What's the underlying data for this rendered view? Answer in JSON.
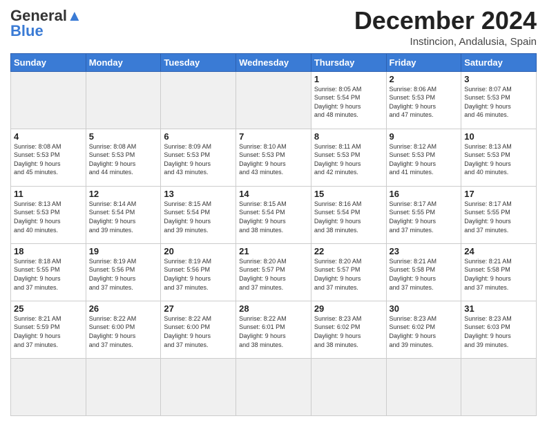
{
  "header": {
    "logo_line1": "General",
    "logo_line2": "Blue",
    "month": "December 2024",
    "location": "Instincion, Andalusia, Spain"
  },
  "weekdays": [
    "Sunday",
    "Monday",
    "Tuesday",
    "Wednesday",
    "Thursday",
    "Friday",
    "Saturday"
  ],
  "days": [
    {
      "num": "",
      "info": ""
    },
    {
      "num": "",
      "info": ""
    },
    {
      "num": "",
      "info": ""
    },
    {
      "num": "",
      "info": ""
    },
    {
      "num": "1",
      "info": "Sunrise: 8:05 AM\nSunset: 5:54 PM\nDaylight: 9 hours\nand 48 minutes."
    },
    {
      "num": "2",
      "info": "Sunrise: 8:06 AM\nSunset: 5:53 PM\nDaylight: 9 hours\nand 47 minutes."
    },
    {
      "num": "3",
      "info": "Sunrise: 8:07 AM\nSunset: 5:53 PM\nDaylight: 9 hours\nand 46 minutes."
    },
    {
      "num": "4",
      "info": "Sunrise: 8:08 AM\nSunset: 5:53 PM\nDaylight: 9 hours\nand 45 minutes."
    },
    {
      "num": "5",
      "info": "Sunrise: 8:08 AM\nSunset: 5:53 PM\nDaylight: 9 hours\nand 44 minutes."
    },
    {
      "num": "6",
      "info": "Sunrise: 8:09 AM\nSunset: 5:53 PM\nDaylight: 9 hours\nand 43 minutes."
    },
    {
      "num": "7",
      "info": "Sunrise: 8:10 AM\nSunset: 5:53 PM\nDaylight: 9 hours\nand 43 minutes."
    },
    {
      "num": "8",
      "info": "Sunrise: 8:11 AM\nSunset: 5:53 PM\nDaylight: 9 hours\nand 42 minutes."
    },
    {
      "num": "9",
      "info": "Sunrise: 8:12 AM\nSunset: 5:53 PM\nDaylight: 9 hours\nand 41 minutes."
    },
    {
      "num": "10",
      "info": "Sunrise: 8:13 AM\nSunset: 5:53 PM\nDaylight: 9 hours\nand 40 minutes."
    },
    {
      "num": "11",
      "info": "Sunrise: 8:13 AM\nSunset: 5:53 PM\nDaylight: 9 hours\nand 40 minutes."
    },
    {
      "num": "12",
      "info": "Sunrise: 8:14 AM\nSunset: 5:54 PM\nDaylight: 9 hours\nand 39 minutes."
    },
    {
      "num": "13",
      "info": "Sunrise: 8:15 AM\nSunset: 5:54 PM\nDaylight: 9 hours\nand 39 minutes."
    },
    {
      "num": "14",
      "info": "Sunrise: 8:15 AM\nSunset: 5:54 PM\nDaylight: 9 hours\nand 38 minutes."
    },
    {
      "num": "15",
      "info": "Sunrise: 8:16 AM\nSunset: 5:54 PM\nDaylight: 9 hours\nand 38 minutes."
    },
    {
      "num": "16",
      "info": "Sunrise: 8:17 AM\nSunset: 5:55 PM\nDaylight: 9 hours\nand 37 minutes."
    },
    {
      "num": "17",
      "info": "Sunrise: 8:17 AM\nSunset: 5:55 PM\nDaylight: 9 hours\nand 37 minutes."
    },
    {
      "num": "18",
      "info": "Sunrise: 8:18 AM\nSunset: 5:55 PM\nDaylight: 9 hours\nand 37 minutes."
    },
    {
      "num": "19",
      "info": "Sunrise: 8:19 AM\nSunset: 5:56 PM\nDaylight: 9 hours\nand 37 minutes."
    },
    {
      "num": "20",
      "info": "Sunrise: 8:19 AM\nSunset: 5:56 PM\nDaylight: 9 hours\nand 37 minutes."
    },
    {
      "num": "21",
      "info": "Sunrise: 8:20 AM\nSunset: 5:57 PM\nDaylight: 9 hours\nand 37 minutes."
    },
    {
      "num": "22",
      "info": "Sunrise: 8:20 AM\nSunset: 5:57 PM\nDaylight: 9 hours\nand 37 minutes."
    },
    {
      "num": "23",
      "info": "Sunrise: 8:21 AM\nSunset: 5:58 PM\nDaylight: 9 hours\nand 37 minutes."
    },
    {
      "num": "24",
      "info": "Sunrise: 8:21 AM\nSunset: 5:58 PM\nDaylight: 9 hours\nand 37 minutes."
    },
    {
      "num": "25",
      "info": "Sunrise: 8:21 AM\nSunset: 5:59 PM\nDaylight: 9 hours\nand 37 minutes."
    },
    {
      "num": "26",
      "info": "Sunrise: 8:22 AM\nSunset: 6:00 PM\nDaylight: 9 hours\nand 37 minutes."
    },
    {
      "num": "27",
      "info": "Sunrise: 8:22 AM\nSunset: 6:00 PM\nDaylight: 9 hours\nand 37 minutes."
    },
    {
      "num": "28",
      "info": "Sunrise: 8:22 AM\nSunset: 6:01 PM\nDaylight: 9 hours\nand 38 minutes."
    },
    {
      "num": "29",
      "info": "Sunrise: 8:23 AM\nSunset: 6:02 PM\nDaylight: 9 hours\nand 38 minutes."
    },
    {
      "num": "30",
      "info": "Sunrise: 8:23 AM\nSunset: 6:02 PM\nDaylight: 9 hours\nand 39 minutes."
    },
    {
      "num": "31",
      "info": "Sunrise: 8:23 AM\nSunset: 6:03 PM\nDaylight: 9 hours\nand 39 minutes."
    },
    {
      "num": "",
      "info": ""
    },
    {
      "num": "",
      "info": ""
    },
    {
      "num": "",
      "info": ""
    },
    {
      "num": "",
      "info": ""
    }
  ]
}
